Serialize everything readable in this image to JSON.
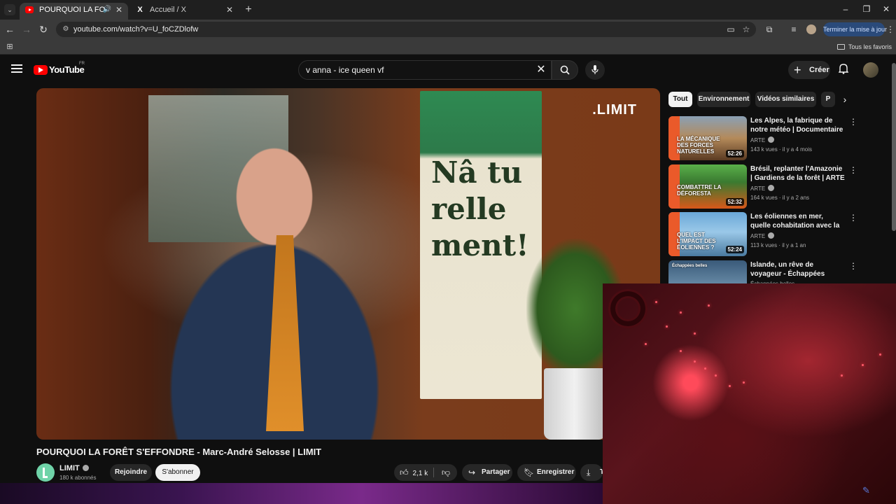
{
  "browser": {
    "tabs": [
      {
        "title": "POURQUOI LA FORÊT S'EFF",
        "active": true
      },
      {
        "title": "Accueil / X",
        "active": false
      }
    ],
    "url": "youtube.com/watch?v=U_foCZDlofw",
    "update_label": "Terminer la mise à jour",
    "bookmarks_all": "Tous les favoris"
  },
  "youtube": {
    "logo": "YouTube",
    "country": "FR",
    "search_value": "v anna - ice queen vf",
    "create_label": "Créer"
  },
  "video": {
    "title": "POURQUOI LA FORÊT S'EFFONDRE - Marc-André Selosse | LIMIT",
    "brand_overlay": ".LIMIT",
    "banner_text": "Nâ tu relle ment!",
    "channel": {
      "name": "LIMIT",
      "subscribers": "180 k abonnés"
    },
    "join_label": "Rejoindre",
    "subscribe_label": "S'abonner",
    "likes": "2,1 k",
    "share_label": "Partager",
    "save_label": "Enregistrer",
    "download_label": "Té"
  },
  "sidebar": {
    "chips": [
      "Tout",
      "Environnement",
      "Vidéos similaires",
      "P"
    ],
    "active_chip": "Tout",
    "recommendations": [
      {
        "title": "Les Alpes, la fabrique de notre météo | Documentaire | ARTE",
        "channel": "ARTE",
        "meta": "143 k vues · il y a 4 mois",
        "duration": "52:26",
        "thumb_text": "LA MÉCANIQUE DES FORCES NATURELLES"
      },
      {
        "title": "Brésil, replanter l'Amazonie | Gardiens de la forêt | ARTE",
        "channel": "ARTE",
        "meta": "164 k vues · il y a 2 ans",
        "duration": "52:32",
        "thumb_text": "COMBATTRE LA DÉFORESTA"
      },
      {
        "title": "Les éoliennes en mer, quelle cohabitation avec la nature ? | ...",
        "channel": "ARTE",
        "meta": "113 k vues · il y a 1 an",
        "duration": "52:24",
        "thumb_text": "QUEL EST L'IMPACT DES ÉOLIENNES ?"
      },
      {
        "title": "Islande, un rêve de voyageur - Échappées belles",
        "channel": "Échappées belles",
        "meta": "",
        "duration": "",
        "thumb_text": "Échappées belles"
      }
    ]
  },
  "colors": {
    "youtube_red": "#ff0000",
    "page_bg": "#0f0f0f",
    "chip_bg": "#272727",
    "update_btn": "#2a4a7a"
  }
}
